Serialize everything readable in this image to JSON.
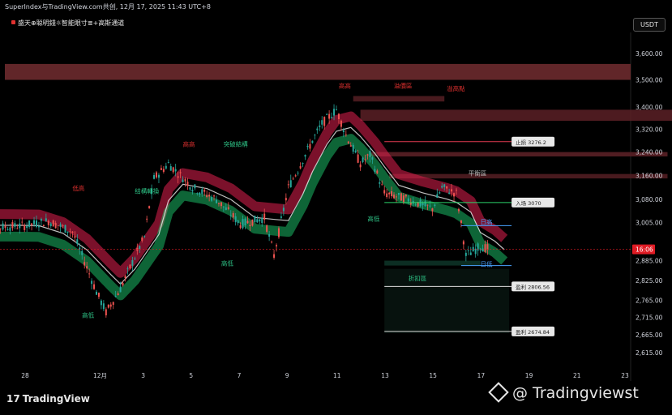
{
  "header": {
    "source": "SuperIndex与TradingView.com共创, 12月 17, 2025 11:43 UTC+8",
    "indicator": "盛天⊕聪明錢☼智能眼寸≣+高斯通道",
    "currency": "USDT"
  },
  "footer": {
    "logo_text": "TradingView",
    "watermark": "@ Tradingviewst"
  },
  "colors": {
    "background": "#000000",
    "up_band": "#1ee07a",
    "down_band": "#e01f4f",
    "candle_up": "#26a69a",
    "candle_down": "#ef5350",
    "price_tag": "#e01b24"
  },
  "chart_data": {
    "type": "candlestick",
    "y_axis": {
      "ticks": [
        "3,600.00",
        "3,500.00",
        "3,400.00",
        "3,320.00",
        "3,240.00",
        "3,160.00",
        "3,080.00",
        "3,005.00",
        "2,885.00",
        "2,825.00",
        "2,765.00",
        "2,715.00",
        "2,665.00",
        "2,615.00"
      ],
      "tick_values": [
        3600,
        3500,
        3400,
        3320,
        3240,
        3160,
        3080,
        3005,
        2885,
        2825,
        2765,
        2715,
        2665,
        2615
      ],
      "scale": "log",
      "range": [
        2580,
        3660
      ]
    },
    "x_axis": {
      "ticks": [
        "28",
        "12月",
        "3",
        "5",
        "7",
        "9",
        "11",
        "13",
        "15",
        "17",
        "19",
        "21",
        "23"
      ]
    },
    "last_price": {
      "label": "16:06",
      "value": 2920
    },
    "price_path": [
      {
        "date": "11-26",
        "value": 3000
      },
      {
        "date": "11-27",
        "value": 2990
      },
      {
        "date": "11-28",
        "value": 2995
      },
      {
        "date": "11-29",
        "value": 3010
      },
      {
        "date": "11-30",
        "value": 2975
      },
      {
        "date": "12-01",
        "value": 2790
      },
      {
        "date": "12-01",
        "value": 2730
      },
      {
        "date": "12-02",
        "value": 2800
      },
      {
        "date": "12-03",
        "value": 2960
      },
      {
        "date": "12-03",
        "value": 3150
      },
      {
        "date": "12-04",
        "value": 3200
      },
      {
        "date": "12-05",
        "value": 3120
      },
      {
        "date": "12-06",
        "value": 3080
      },
      {
        "date": "12-07",
        "value": 3000
      },
      {
        "date": "12-08",
        "value": 3020
      },
      {
        "date": "12-08",
        "value": 2900
      },
      {
        "date": "12-09",
        "value": 3120
      },
      {
        "date": "12-09",
        "value": 3180
      },
      {
        "date": "12-10",
        "value": 3280
      },
      {
        "date": "12-10",
        "value": 3340
      },
      {
        "date": "12-11",
        "value": 3390
      },
      {
        "date": "12-11",
        "value": 3300
      },
      {
        "date": "12-12",
        "value": 3200
      },
      {
        "date": "12-12",
        "value": 3230
      },
      {
        "date": "12-13",
        "value": 3100
      },
      {
        "date": "12-14",
        "value": 3080
      },
      {
        "date": "12-15",
        "value": 3050
      },
      {
        "date": "12-15",
        "value": 3120
      },
      {
        "date": "12-16",
        "value": 3100
      },
      {
        "date": "12-16",
        "value": 2900
      },
      {
        "date": "12-17",
        "value": 2930
      },
      {
        "date": "12-17",
        "value": 2920
      }
    ],
    "horizontal_levels": [
      {
        "label": "止损 3276.2",
        "value": 3276.2,
        "color": "#e03a50",
        "icon": "cross-icon"
      },
      {
        "label": "入场 3070",
        "value": 3070,
        "color": "#2bd46a",
        "icon": "check-icon"
      },
      {
        "label": "盈利 2806.56",
        "value": 2806.56,
        "color": "#dcdcdc",
        "icon": "target-icon",
        "badge": "2"
      },
      {
        "label": "盈利 2674.84",
        "value": 2674.84,
        "color": "#dcdcdc",
        "icon": "target-icon",
        "badge": "3"
      }
    ],
    "text_annotations": [
      {
        "text": "低高",
        "color": "#e0312f"
      },
      {
        "text": "结構轉換",
        "color": "#2fc98a"
      },
      {
        "text": "高高",
        "color": "#e0312f"
      },
      {
        "text": "突破結構",
        "color": "#2fc98a"
      },
      {
        "text": "高高",
        "color": "#e0312f"
      },
      {
        "text": "溢價區",
        "color": "#e0312f"
      },
      {
        "text": "溢高點",
        "color": "#e0312f"
      },
      {
        "text": "平衡區",
        "color": "#bdbdbd"
      },
      {
        "text": "日高",
        "color": "#4aa3ff"
      },
      {
        "text": "日低",
        "color": "#4aa3ff"
      },
      {
        "text": "折扣區",
        "color": "#2fc98a"
      },
      {
        "text": "高低",
        "color": "#2fc98a"
      },
      {
        "text": "高低",
        "color": "#2fc98a"
      },
      {
        "text": "高低",
        "color": "#2fc98a"
      }
    ]
  }
}
